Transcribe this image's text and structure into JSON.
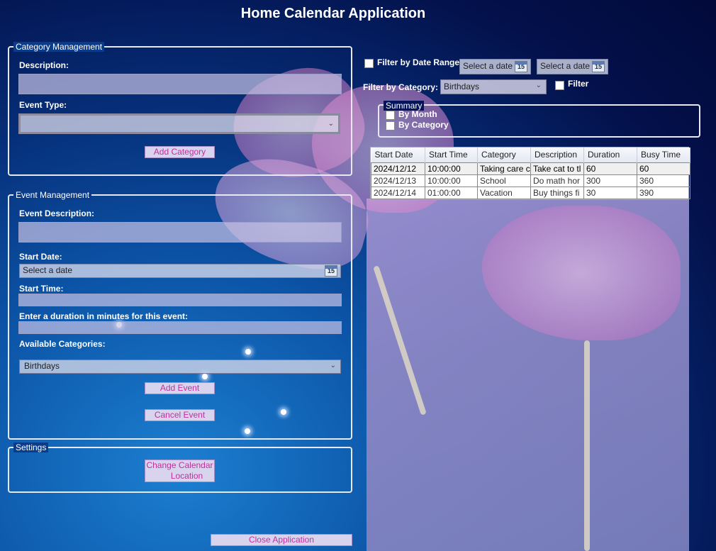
{
  "app": {
    "title": "Home Calendar Application"
  },
  "category_management": {
    "legend": "Category Management",
    "description_label": "Description:",
    "description_value": "",
    "event_type_label": "Event Type:",
    "event_type_value": "",
    "add_button": "Add Category"
  },
  "event_management": {
    "legend": "Event Management",
    "event_description_label": "Event Description:",
    "event_description_value": "",
    "start_date_label": "Start Date:",
    "start_date_placeholder": "Select a date",
    "calendar_icon_text": "15",
    "start_time_label": "Start Time:",
    "start_time_value": "",
    "duration_label": "Enter a duration in minutes for this event:",
    "duration_value": "",
    "categories_label": "Available Categories:",
    "categories_selected": "Birthdays",
    "add_button": "Add Event",
    "cancel_button": "Cancel Event"
  },
  "settings": {
    "legend": "Settings",
    "change_location_line1": "Change Calendar",
    "change_location_line2": "Location"
  },
  "close_button": "Close Application",
  "filters": {
    "date_range_label": "Filter by Date Range",
    "date_from_placeholder": "Select a date",
    "date_to_placeholder": "Select a date",
    "calendar_icon_text": "15",
    "category_label": "Filter by Category:",
    "category_selected": "Birthdays",
    "filter_label": "Filter"
  },
  "summary": {
    "legend": "Summary",
    "by_month": "By Month",
    "by_category": "By Category"
  },
  "grid": {
    "columns": [
      "Start Date",
      "Start Time",
      "Category",
      "Description",
      "Duration",
      "Busy Time"
    ],
    "rows": [
      [
        "2024/12/12",
        "10:00:00",
        "Taking care c",
        "Take cat to tl",
        "60",
        "60"
      ],
      [
        "2024/12/13",
        "10:00:00",
        "School",
        "Do math hor",
        "300",
        "360"
      ],
      [
        "2024/12/14",
        "01:00:00",
        "Vacation",
        "Buy things fi",
        "30",
        "390"
      ]
    ]
  },
  "colors": {
    "button_text": "#c0309a",
    "button_bg": "#d9d4ee",
    "background_dark": "#020a3a",
    "background_light": "#1c7fd0"
  }
}
